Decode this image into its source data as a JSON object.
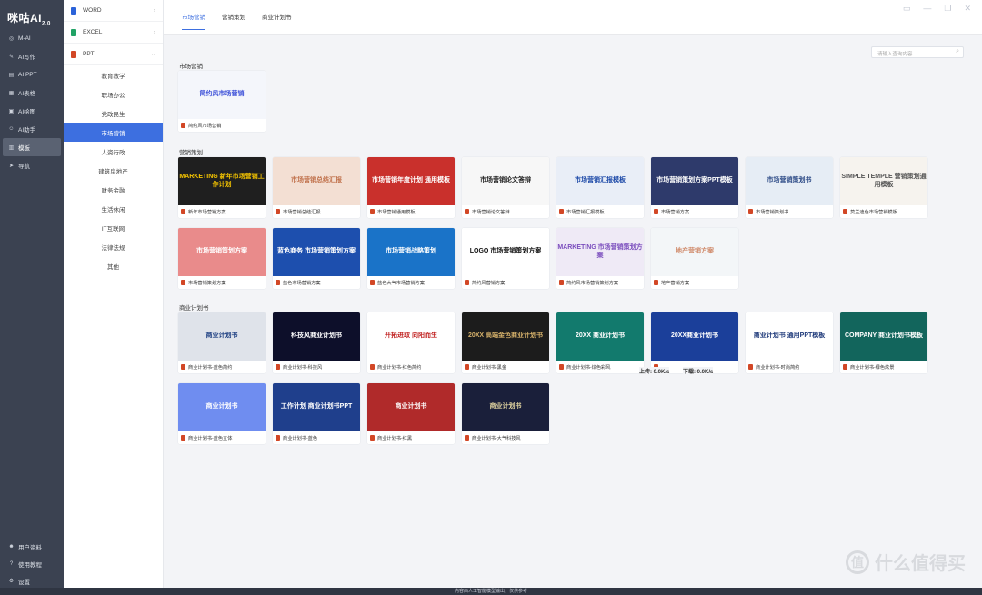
{
  "app": {
    "logo": "咪咕AI",
    "version": "2.0"
  },
  "window_controls": [
    "▭",
    "—",
    "❐",
    "✕"
  ],
  "left_nav": {
    "items": [
      {
        "label": "M-AI",
        "icon": "chat-icon"
      },
      {
        "label": "AI写作",
        "icon": "pen-icon"
      },
      {
        "label": "AI PPT",
        "icon": "ppt-icon"
      },
      {
        "label": "AI表格",
        "icon": "table-icon"
      },
      {
        "label": "AI绘图",
        "icon": "image-icon"
      },
      {
        "label": "AI助手",
        "icon": "assistant-icon"
      },
      {
        "label": "模板",
        "icon": "template-icon"
      },
      {
        "label": "导航",
        "icon": "navigation-icon"
      }
    ],
    "bottom": [
      {
        "label": "用户资料",
        "icon": "user-icon"
      },
      {
        "label": "使用教程",
        "icon": "help-icon"
      },
      {
        "label": "设置",
        "icon": "gear-icon"
      }
    ]
  },
  "sub_nav": {
    "categories": [
      "WORD",
      "EXCEL",
      "PPT"
    ],
    "items": [
      "教育教学",
      "职场办公",
      "党政民生",
      "市场营销",
      "人资行政",
      "建筑房地产",
      "财务金融",
      "生活休闲",
      "IT互联网",
      "法律法规",
      "其他"
    ]
  },
  "tabs": [
    "市场营销",
    "营销策划",
    "商业计划书"
  ],
  "search": {
    "placeholder": "请输入查询内容"
  },
  "sections": [
    {
      "title": "市场营销",
      "cards": [
        {
          "caption": "简约风市场营销",
          "thumb_text": "简约风市场营销",
          "bg": "#f4f6fb",
          "fg": "#3b4fd8"
        }
      ]
    },
    {
      "title": "营销策划",
      "cards": [
        {
          "caption": "新年市场营销方案",
          "thumb_text": "MARKETING 新年市场营销工作计划",
          "bg": "#1f1f1f",
          "fg": "#f5c400"
        },
        {
          "caption": "市场营销总结汇报",
          "thumb_text": "市场营销总结汇报",
          "bg": "#f3dfd3",
          "fg": "#c0714b"
        },
        {
          "caption": "市场营销通用模板",
          "thumb_text": "市场营销年度计划 通用模板",
          "bg": "#c9302c",
          "fg": "#ffffff"
        },
        {
          "caption": "市场营销论文答辩",
          "thumb_text": "市场营销论文答辩",
          "bg": "#f7f7f7",
          "fg": "#222222"
        },
        {
          "caption": "市场营销汇报模板",
          "thumb_text": "市场营销汇报模板",
          "bg": "#e9eef7",
          "fg": "#1e4aa8"
        },
        {
          "caption": "市场营销方案",
          "thumb_text": "市场营销策划方案PPT模板",
          "bg": "#2e3a6b",
          "fg": "#ffffff"
        },
        {
          "caption": "市场营销策划书",
          "thumb_text": "市场营销策划书",
          "bg": "#e6edf5",
          "fg": "#2c4a86"
        },
        {
          "caption": "莫兰迪色市场营销模板",
          "thumb_text": "SIMPLE TEMPLE 营销策划通用模板",
          "bg": "#f6f3ee",
          "fg": "#555555"
        },
        {
          "caption": "市场营销策划方案",
          "thumb_text": "市场营销策划方案",
          "bg": "#e98b8b",
          "fg": "#ffffff"
        },
        {
          "caption": "蓝色市场营销方案",
          "thumb_text": "蓝色商务 市场营销策划方案",
          "bg": "#1d4fae",
          "fg": "#ffffff"
        },
        {
          "caption": "蓝色大气市场营销方案",
          "thumb_text": "市场营销战略策划",
          "bg": "#1a73c8",
          "fg": "#ffffff"
        },
        {
          "caption": "简约风营销方案",
          "thumb_text": "LOGO 市场营销策划方案",
          "bg": "#ffffff",
          "fg": "#111111"
        },
        {
          "caption": "简约风市场营销策划方案",
          "thumb_text": "MARKETING 市场营销策划方案",
          "bg": "#efeaf6",
          "fg": "#7a4dbd"
        },
        {
          "caption": "地产营销方案",
          "thumb_text": "地产营销方案",
          "bg": "#f3f6f8",
          "fg": "#d08a6a"
        }
      ]
    },
    {
      "title": "商业计划书",
      "cards": [
        {
          "caption": "商业计划书-蓝色简约",
          "thumb_text": "商业计划书",
          "bg": "#dfe3ea",
          "fg": "#1d3f82"
        },
        {
          "caption": "商业计划书-科技风",
          "thumb_text": "科技风商业计划书",
          "bg": "#0d0f2a",
          "fg": "#ffffff"
        },
        {
          "caption": "商业计划书-红色简约",
          "thumb_text": "开拓进取 向阳而生",
          "bg": "#ffffff",
          "fg": "#c0201f"
        },
        {
          "caption": "商业计划书-黑金",
          "thumb_text": "20XX 高端金色商业计划书",
          "bg": "#1c1c1c",
          "fg": "#d4b06a"
        },
        {
          "caption": "商业计划书-炫色彩风",
          "thumb_text": "20XX 商业计划书",
          "bg": "#127a6d",
          "fg": "#ffffff"
        },
        {
          "caption": "",
          "thumb_text": "20XX商业计划书",
          "bg": "#1b3f9a",
          "fg": "#ffffff"
        },
        {
          "caption": "商业计划书-时尚简约",
          "thumb_text": "商业计划书 通用PPT模板",
          "bg": "#ffffff",
          "fg": "#1f3a7a"
        },
        {
          "caption": "商业计划书-绿色炫景",
          "thumb_text": "COMPANY 商业计划书模板",
          "bg": "#12655c",
          "fg": "#ffffff"
        },
        {
          "caption": "商业计划书-蓝色立体",
          "thumb_text": "商业计划书",
          "bg": "#6f8df0",
          "fg": "#ffffff"
        },
        {
          "caption": "商业计划书-蓝色",
          "thumb_text": "工作计划 商业计划书PPT",
          "bg": "#1f3f8c",
          "fg": "#ffffff"
        },
        {
          "caption": "商业计划书-红黑",
          "thumb_text": "商业计划书",
          "bg": "#b02a2a",
          "fg": "#ffffff"
        },
        {
          "caption": "商业计划书-大气科技风",
          "thumb_text": "商业计划书",
          "bg": "#1a1f3a",
          "fg": "#e0d3a0"
        }
      ]
    }
  ],
  "net_speed": {
    "up": "上传: 0.0K/s",
    "down": "下载: 0.0K/s"
  },
  "status_bar": "内容由人工智能模型输出，仅供参考",
  "watermark": "什么值得买",
  "colors": {
    "accent": "#3d6fe0",
    "sidebar": "#3b4251",
    "ppt": "#d24726"
  }
}
